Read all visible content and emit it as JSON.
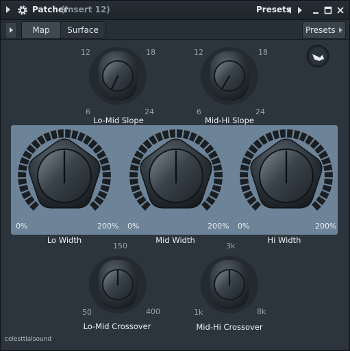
{
  "window": {
    "title": "Patcher",
    "subtitle": "(Insert 12)",
    "presets_label": "Presets"
  },
  "toolbar": {
    "tabs": [
      {
        "label": "Map",
        "active": false
      },
      {
        "label": "Surface",
        "active": true
      }
    ],
    "presets_label": "Presets"
  },
  "knobs": {
    "lo_mid_slope": {
      "name": "Lo-Mid Slope",
      "min": "6",
      "lo": "12",
      "hi": "18",
      "max": "24"
    },
    "mid_hi_slope": {
      "name": "Mid-Hi Slope",
      "min": "6",
      "lo": "12",
      "hi": "18",
      "max": "24"
    },
    "lo_width": {
      "name": "Lo Width",
      "min": "0%",
      "max": "200%"
    },
    "mid_width": {
      "name": "Mid Width",
      "min": "0%",
      "max": "200%"
    },
    "hi_width": {
      "name": "Hi Width",
      "min": "0%",
      "max": "200%"
    },
    "lo_mid_crossover": {
      "name": "Lo-Mid Crossover",
      "min": "50",
      "mid": "150",
      "max": "400"
    },
    "mid_hi_crossover": {
      "name": "Mid-Hi Crossover",
      "min": "1k",
      "mid": "3k",
      "max": "8k"
    }
  },
  "footer": {
    "brand": "celesttialsound"
  },
  "colors": {
    "panel": "#6d8498",
    "background": "#2c353d",
    "knob_indicator": "#0d1114"
  },
  "icons": {
    "reset": "reset-icon",
    "gear": "gear-icon"
  }
}
